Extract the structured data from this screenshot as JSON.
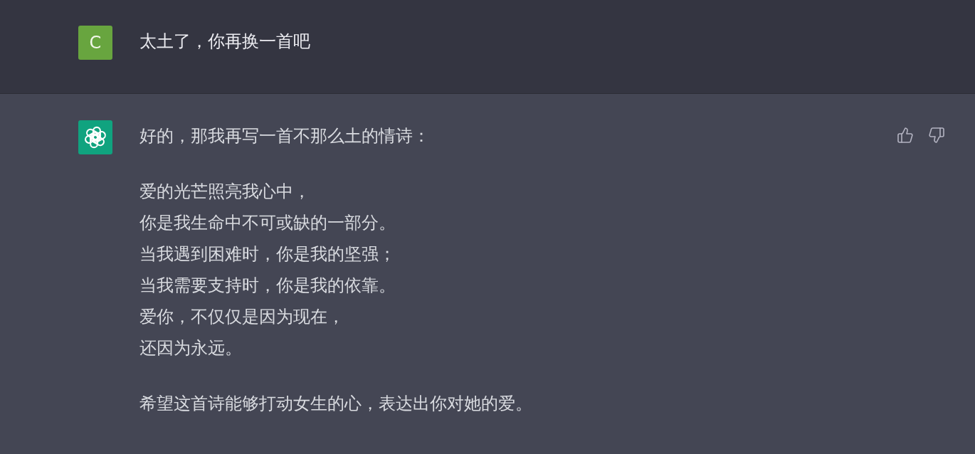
{
  "conversation": [
    {
      "kind": "user",
      "avatar": "C",
      "paragraphs": [
        {
          "lines": [
            "太土了，你再换一首吧"
          ]
        }
      ]
    },
    {
      "kind": "assistant",
      "paragraphs": [
        {
          "lines": [
            "好的，那我再写一首不那么土的情诗："
          ]
        },
        {
          "lines": [
            "爱的光芒照亮我心中，",
            "你是我生命中不可或缺的一部分。",
            "当我遇到困难时，你是我的坚强；",
            "当我需要支持时，你是我的依靠。",
            "爱你，不仅仅是因为现在，",
            "还因为永远。"
          ]
        },
        {
          "lines": [
            "希望这首诗能够打动女生的心，表达出你对她的爱。"
          ]
        }
      ]
    }
  ]
}
